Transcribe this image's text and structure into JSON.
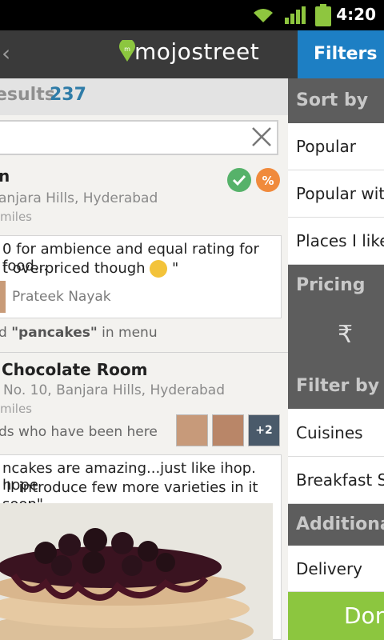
{
  "status_bar": {
    "time": "4:20"
  },
  "app_bar": {
    "back_label": "‹",
    "logo_text": "mojostreet",
    "filters_tab": "Filters"
  },
  "results": {
    "label": "esults",
    "count": "237"
  },
  "search": {
    "value": "",
    "placeholder": ""
  },
  "listings": [
    {
      "name": "n",
      "address": "anjara Hills, Hyderabad",
      "distance": "miles",
      "review_line1": "0 for ambience and equal rating for food...",
      "review_line2_prefix": "t overpriced though ",
      "review_line2_suffix": " \"",
      "author": "Prateek Nayak",
      "menu_prefix": "d ",
      "menu_keyword": "\"pancakes\"",
      "menu_suffix": " in menu"
    },
    {
      "name": "Chocolate Room",
      "address": "No. 10, Banjara Hills, Hyderabad",
      "distance": "miles",
      "friends_text": "ds who have been here",
      "friends_more": "+2",
      "review_line1": "ncakes are amazing...just like ihop. hope",
      "review_line2": "'ll introduce few more varieties in it soon\""
    }
  ],
  "filters_panel": {
    "sort_by": "Sort by",
    "sort_options": [
      "Popular",
      "Popular with",
      "Places I like"
    ],
    "pricing": "Pricing",
    "price_symbol": "₹",
    "filter_by": "Filter by",
    "filter_options": [
      "Cuisines",
      "Breakfast Sp"
    ],
    "additional": "Additiona",
    "additional_options": [
      "Delivery"
    ],
    "done": "Done"
  }
}
